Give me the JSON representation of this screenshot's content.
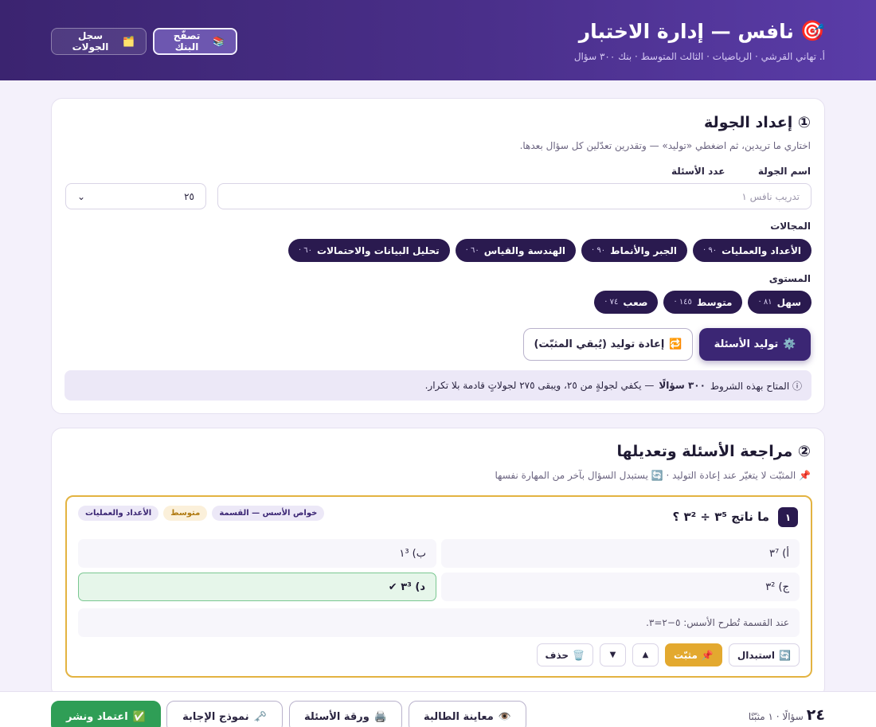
{
  "header": {
    "title": "نافس — إدارة الاختبار",
    "subtitle": "أ. تهاني القرشي · الرياضيات · الثالث المتوسط · بنك ٣٠٠ سؤال",
    "bank_button": "تصفّح البنك",
    "log_button": "سجل الجولات"
  },
  "setup": {
    "title": "① إعداد الجولة",
    "subtitle": "اختاري ما تريدين، ثم اضغطي «توليد» — وتقدرين تعدّلين كل سؤال بعدها.",
    "name_label": "اسم الجولة",
    "name_placeholder": "تدريب نافس ١",
    "count_label": "عدد الأسئلة",
    "count_value": "٢٥",
    "domains_label": "المجالات",
    "domains": [
      {
        "label": "الأعداد والعمليات",
        "count": "٩٠ ·"
      },
      {
        "label": "الجبر والأنماط",
        "count": "٩٠ ·"
      },
      {
        "label": "الهندسة والقياس",
        "count": "٦٠ ·"
      },
      {
        "label": "تحليل البيانات والاحتمالات",
        "count": "٦٠ ·"
      }
    ],
    "levels_label": "المستوى",
    "levels": [
      {
        "label": "سهل",
        "count": "٨١ ·"
      },
      {
        "label": "متوسط",
        "count": "١٤٥ ·"
      },
      {
        "label": "صعب",
        "count": "٧٤ ·"
      }
    ],
    "generate_button": "توليد الأسئلة",
    "regenerate_button": "إعادة توليد (يُبقي المثبّت)",
    "info_prefix": "ⓘ المتاح بهذه الشروط",
    "info_bold": "٣٠٠ سؤالًا",
    "info_suffix": "— يكفي لجولةٍ من ٢٥، ويبقى ٢٧٥ لجولاتٍ قادمة بلا تكرار."
  },
  "review": {
    "title": "② مراجعة الأسئلة وتعديلها",
    "subtitle": "📌 المثبّت لا يتغيّر عند إعادة التوليد · 🔄 يستبدل السؤال بآخر من المهارة نفسها",
    "question": {
      "number": "١",
      "text": "ما ناتج ٣⁵ ÷ ٣² ؟",
      "tag_domain": "الأعداد والعمليات",
      "tag_level": "متوسط",
      "tag_skill": "خواص الأسس — القسمة",
      "options": [
        "أ) ٣⁷",
        "ب) ١³",
        "ج) ٣²",
        "د) ٣³ ✔"
      ],
      "explanation": "عند القسمة تُطرح الأسس: ٥−٢=٣.",
      "replace_button": "استبدال",
      "pinned_button": "مثبّت",
      "up_button": "▲",
      "down_button": "▼",
      "delete_button": "حذف"
    }
  },
  "footer": {
    "count": "٢٤",
    "stats": "سؤالًا · ١ مثبّتًا",
    "preview_button": "معاينة الطالبة",
    "sheet_button": "ورقة الأسئلة",
    "answer_key_button": "نموذج الإجابة",
    "publish_button": "اعتماد ونشر"
  },
  "colors": {
    "header_bg": "#3b2470",
    "accent": "#2a1a4f",
    "pinned": "#e3a92f",
    "correct": "#2f9e56"
  },
  "icons": [
    "target-icon",
    "books-icon",
    "folder-icon",
    "gear-icon",
    "refresh-icon",
    "info-icon",
    "pin-icon",
    "trash-icon",
    "eye-icon",
    "printer-icon",
    "key-icon",
    "check-icon"
  ]
}
